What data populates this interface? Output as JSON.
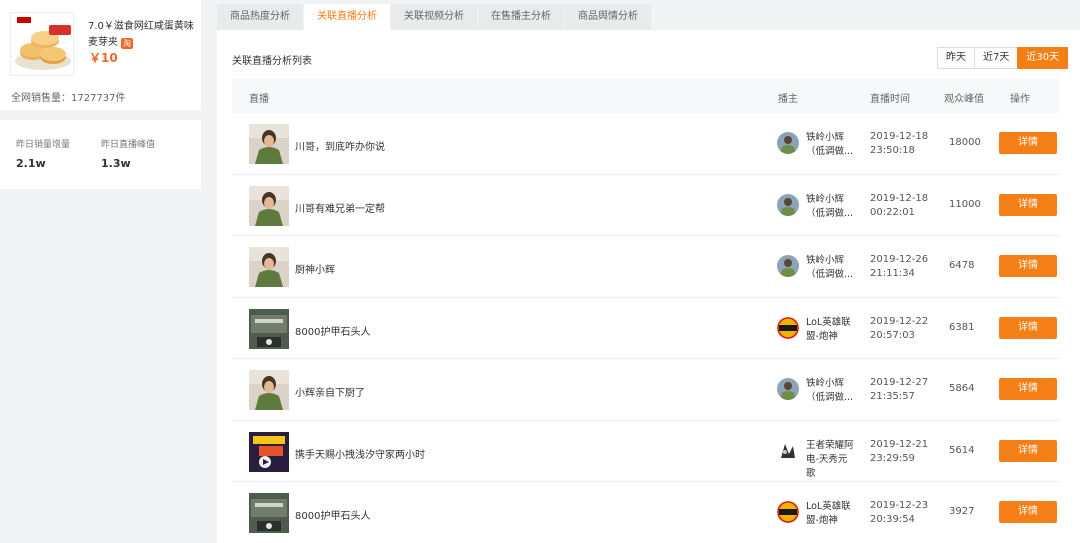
{
  "product": {
    "title": "7.0￥滋食网红咸蛋黄味麦芽夹",
    "tmall_badge": "淘",
    "price": "￥10",
    "total_sales": "全网销售量：1727737件"
  },
  "stats": [
    {
      "label": "昨日销量增量",
      "value": "2.1w"
    },
    {
      "label": "昨日直播峰值",
      "value": "1.3w"
    }
  ],
  "tabs": [
    "商品热度分析",
    "关联直播分析",
    "关联视频分析",
    "在售播主分析",
    "商品舆情分析"
  ],
  "active_tab": 1,
  "list": {
    "title": "关联直播分析列表",
    "range_buttons": [
      "昨天",
      "近7天",
      "近30天"
    ],
    "active_range": 2,
    "columns": [
      "直播",
      "播主",
      "直播时间",
      "观众峰值",
      "操作"
    ],
    "rows": [
      {
        "title": "川哥，到底咋办你说",
        "anchor": "铁岭小辉（低调做...",
        "date": "2019-12-18",
        "time": "23:50:18",
        "peak": "18000",
        "thumb": "person",
        "avatar": "person"
      },
      {
        "title": "川哥有难兄弟一定帮",
        "anchor": "铁岭小辉（低调做...",
        "date": "2019-12-18",
        "time": "00:22:01",
        "peak": "11000",
        "thumb": "person",
        "avatar": "person"
      },
      {
        "title": "厨神小辉",
        "anchor": "铁岭小辉（低调做...",
        "date": "2019-12-26",
        "time": "21:11:34",
        "peak": "6478",
        "thumb": "person",
        "avatar": "person"
      },
      {
        "title": "8000护甲石头人",
        "anchor": "LoL英雄联盟-炮神",
        "date": "2019-12-22",
        "time": "20:57:03",
        "peak": "6381",
        "thumb": "game",
        "avatar": "lol"
      },
      {
        "title": "小辉亲自下厨了",
        "anchor": "铁岭小辉（低调做...",
        "date": "2019-12-27",
        "time": "21:35:57",
        "peak": "5864",
        "thumb": "person",
        "avatar": "person"
      },
      {
        "title": "携手天赐小拽浅汐守家两小时",
        "anchor": "王者荣耀阿电-天秀元歌",
        "date": "2019-12-21",
        "time": "23:29:59",
        "peak": "5614",
        "thumb": "wzry",
        "avatar": "wzry"
      },
      {
        "title": "8000护甲石头人",
        "anchor": "LoL英雄联盟-炮神",
        "date": "2019-12-23",
        "time": "20:39:54",
        "peak": "3927",
        "thumb": "game",
        "avatar": "lol"
      }
    ],
    "detail_label": "详情"
  }
}
